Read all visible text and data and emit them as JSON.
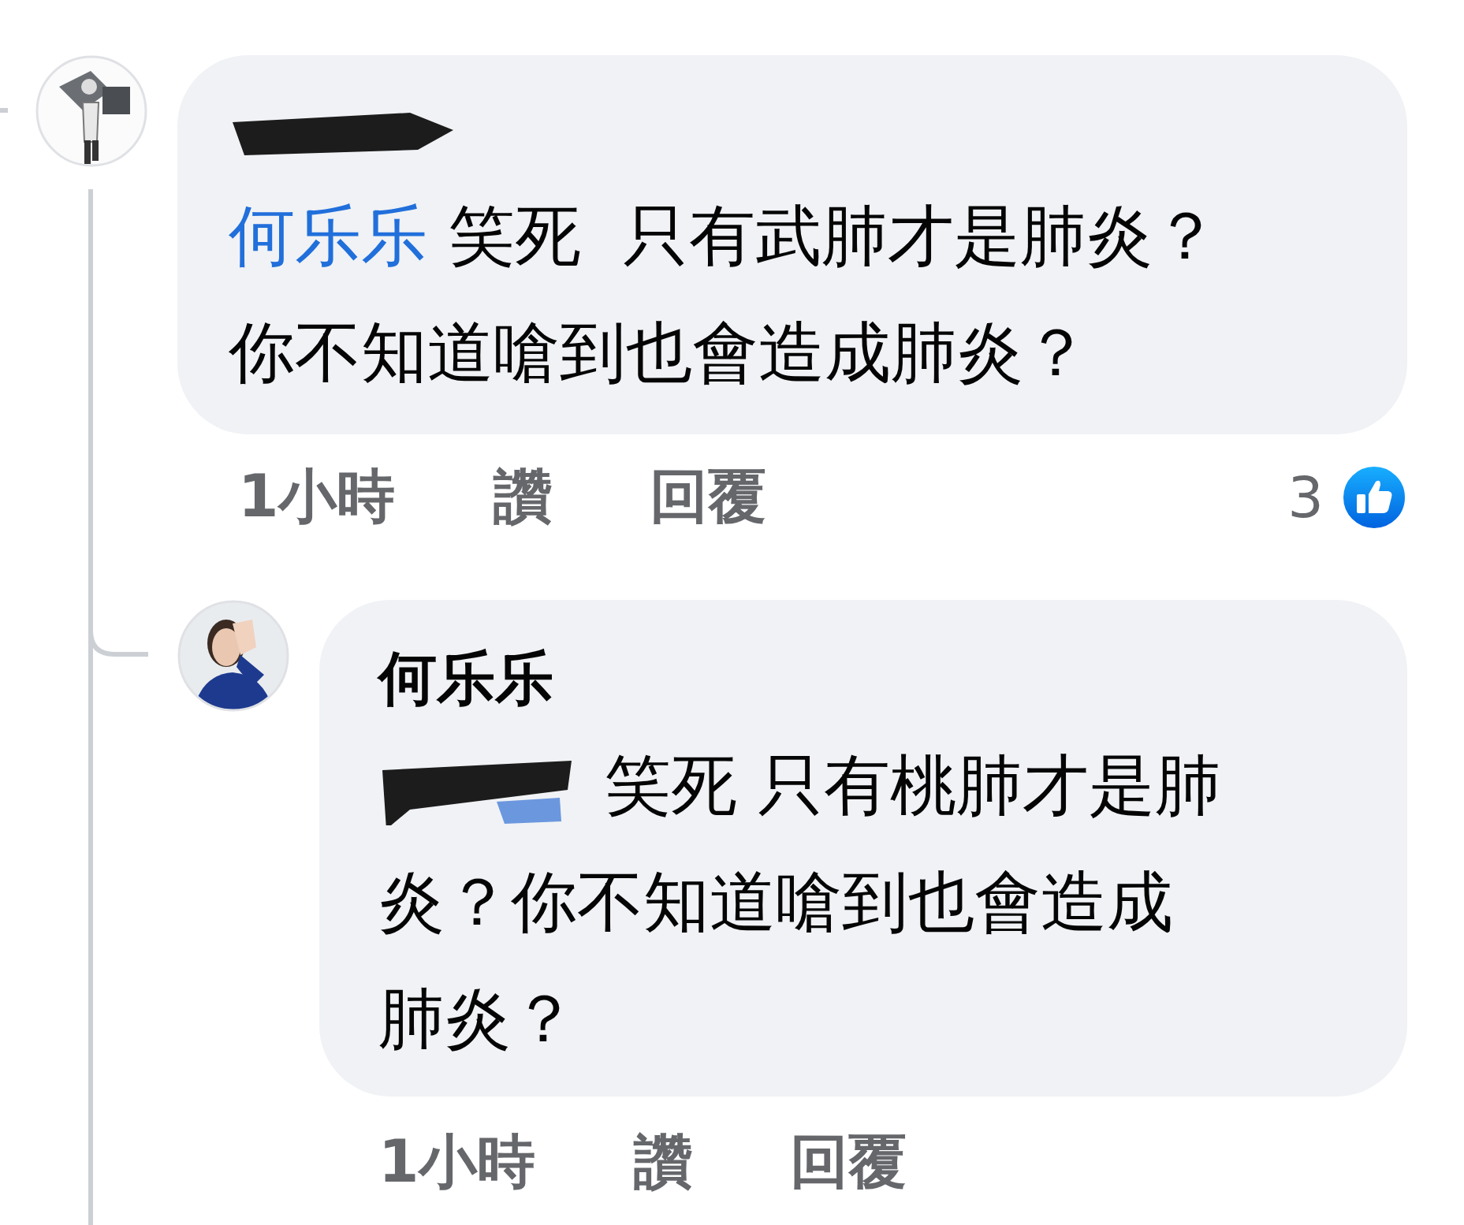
{
  "comments": [
    {
      "author_redacted": true,
      "mention": "何乐乐",
      "text": "笑死  只有武肺才是肺炎？你不知道嗆到也會造成肺炎？",
      "time": "1小時",
      "like": "讚",
      "reply": "回覆",
      "reaction_count": "3"
    },
    {
      "author": "何乐乐",
      "mention_redacted": true,
      "text": "笑死 只有桃肺才是肺炎？你不知道嗆到也會造成肺炎？",
      "time": "1小時",
      "like": "讚",
      "reply": "回覆"
    }
  ]
}
